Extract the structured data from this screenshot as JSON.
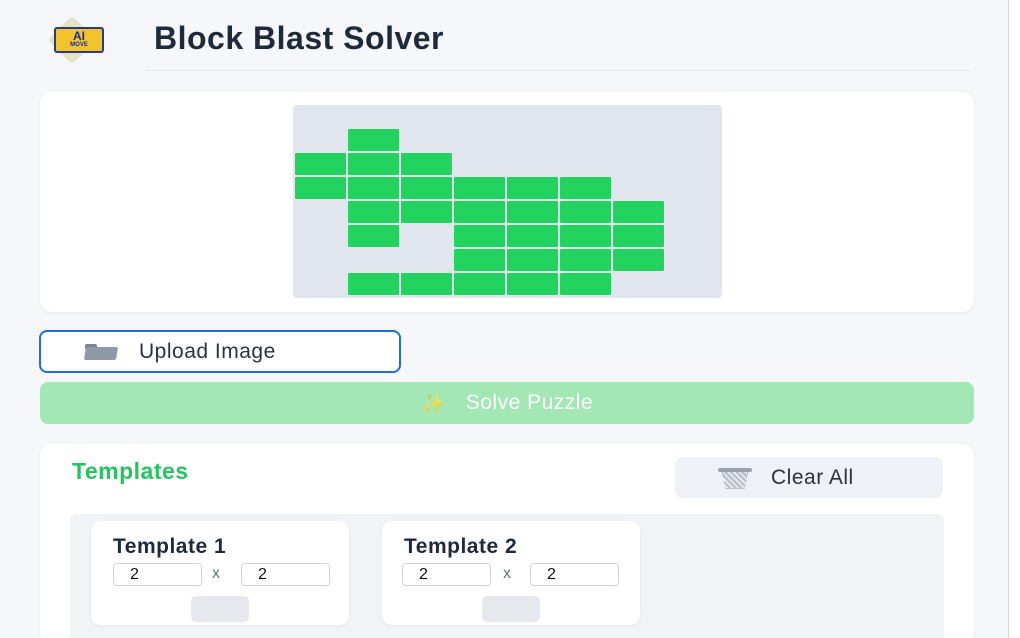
{
  "header": {
    "logo_text": "AI",
    "logo_subtext": "MOVE",
    "title": "Block Blast Solver"
  },
  "board": {
    "cell_color": "#22d45f",
    "background_color": "#e1e6ee"
  },
  "actions": {
    "upload_icon": "folder-icon",
    "upload_label": "Upload Image",
    "solve_icon": "sparkles-icon",
    "solve_label": "Solve Puzzle"
  },
  "templates": {
    "title": "Templates",
    "clear_icon": "wastebasket-icon",
    "clear_label": "Clear All",
    "items": [
      {
        "name": "Template 1",
        "rows": "2",
        "cols": "2",
        "separator": "x"
      },
      {
        "name": "Template 2",
        "rows": "2",
        "cols": "2",
        "separator": "x"
      }
    ]
  },
  "colors": {
    "accent_green": "#22c55e",
    "primary_blue": "#1e6ed8",
    "solve_disabled": "#a3e8b4"
  }
}
